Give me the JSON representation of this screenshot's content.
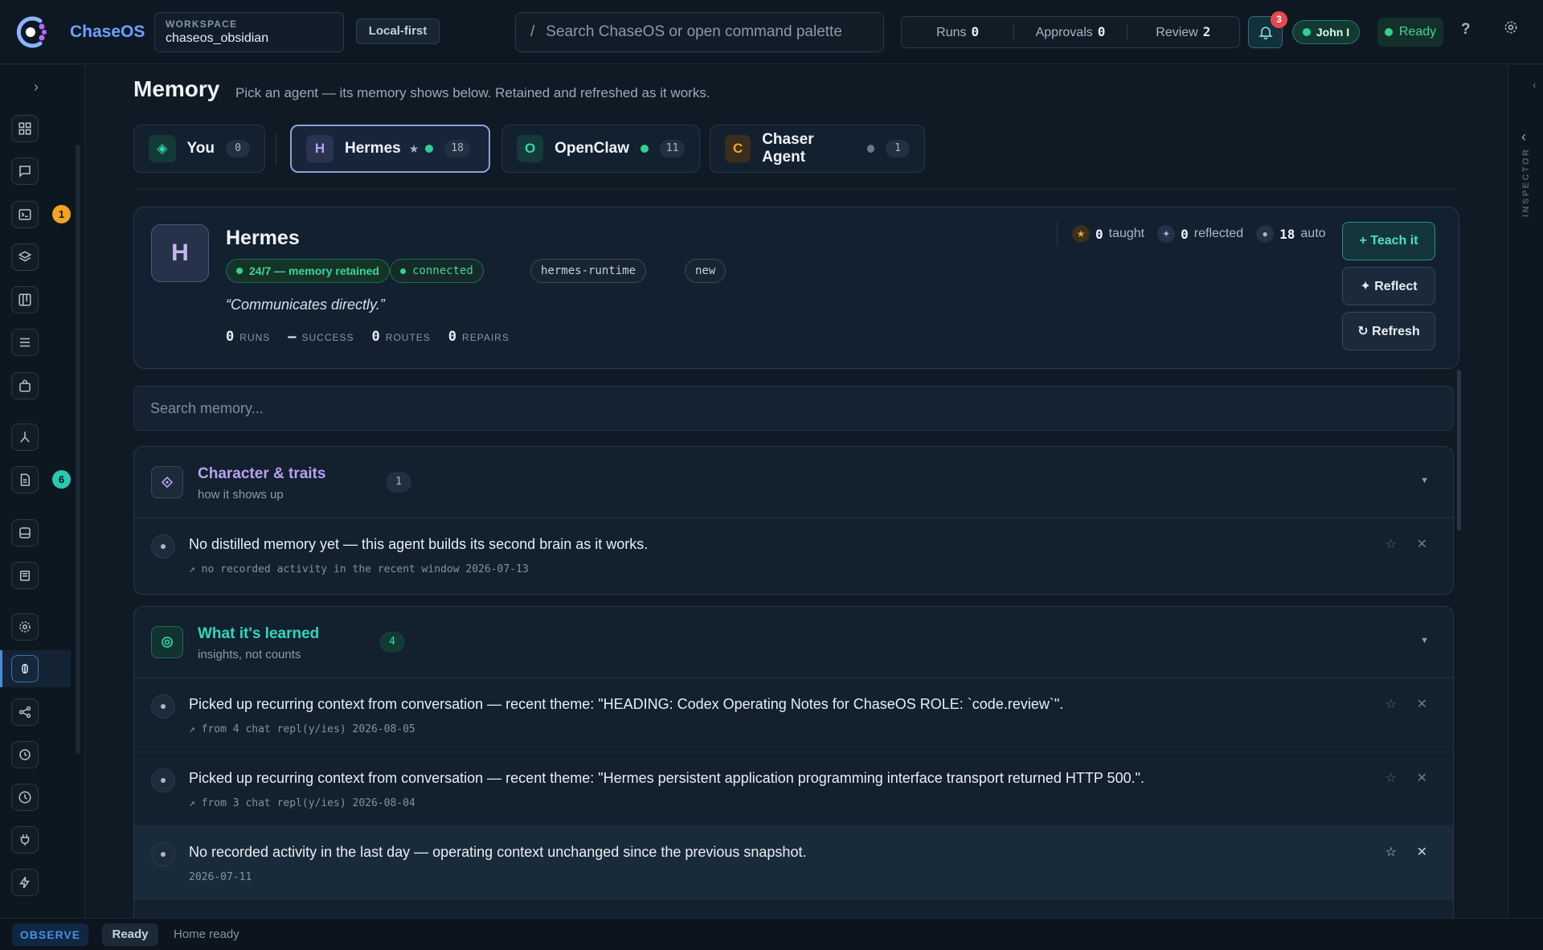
{
  "app": {
    "title": "ChaseOS",
    "workspace_label": "WORKSPACE",
    "workspace_name": "chaseos_obsidian",
    "mode_chip": "Local-first",
    "search_prefix": "/",
    "search_placeholder": "Search ChaseOS or open command palette"
  },
  "header_stats": [
    {
      "label": "Runs",
      "value": "0"
    },
    {
      "label": "Approvals",
      "value": "0"
    },
    {
      "label": "Review",
      "value": "2"
    }
  ],
  "notifications": {
    "count": "3"
  },
  "user": {
    "name": "John I"
  },
  "status_chip": {
    "label": "Ready",
    "color": "#2fd28d"
  },
  "nav": {
    "badges": {
      "runs": "1",
      "docs": "6"
    }
  },
  "inspector": {
    "label": "INSPECTOR"
  },
  "page": {
    "title": "Memory",
    "subtitle": "Pick an agent — its memory shows below. Retained and refreshed as it works."
  },
  "agent_tabs": [
    {
      "name": "You",
      "count": "0",
      "avatar": "◈",
      "active": false
    },
    {
      "name": "Hermes",
      "count": "18",
      "avatar": "H",
      "active": true
    },
    {
      "name": "OpenClaw",
      "count": "11",
      "avatar": "O",
      "active": false
    },
    {
      "name": "Chaser Agent",
      "count": "1",
      "avatar": "C",
      "active": false
    }
  ],
  "agent": {
    "initial": "H",
    "name": "Hermes",
    "tags": [
      "24/7 — memory retained",
      "connected",
      "hermes-runtime",
      "new"
    ],
    "quote": "“Communicates directly.”",
    "metrics": [
      {
        "value": "0",
        "label": "RUNS"
      },
      {
        "value": "–",
        "label": "SUCCESS"
      },
      {
        "value": "0",
        "label": "ROUTES"
      },
      {
        "value": "0",
        "label": "REPAIRS"
      }
    ],
    "counts": [
      {
        "value": "0",
        "label": "taught"
      },
      {
        "value": "0",
        "label": "reflected"
      },
      {
        "value": "18",
        "label": "auto"
      }
    ],
    "buttons": {
      "teach": "+ Teach it",
      "reflect": "✦ Reflect",
      "refresh": "↻ Refresh"
    }
  },
  "memory_search": {
    "placeholder": "Search memory..."
  },
  "sections": [
    {
      "title": "Character & traits",
      "subtitle": "how it shows up",
      "count": "1",
      "items": [
        {
          "text": "No distilled memory yet — this agent builds its second brain as it works.",
          "meta": "↗ no recorded activity in the recent window  2026-07-13"
        }
      ]
    },
    {
      "title": "What it's learned",
      "subtitle": "insights, not counts",
      "count": "4",
      "items": [
        {
          "text": "Picked up recurring context from conversation — recent theme: \"HEADING: Codex Operating Notes for ChaseOS ROLE: `code.review`\".",
          "meta": "↗ from 4 chat repl(y/ies)  2026-08-05"
        },
        {
          "text": "Picked up recurring context from conversation — recent theme: \"Hermes persistent application programming interface transport returned HTTP 500.\".",
          "meta": "↗ from 3 chat repl(y/ies)  2026-08-04"
        },
        {
          "text": "No recorded activity in the last day — operating context unchanged since the previous snapshot.",
          "meta": "2026-07-11"
        }
      ]
    }
  ],
  "bottom": {
    "mode": "OBSERVE",
    "status": "Ready",
    "message": "Home ready"
  },
  "colors": {
    "accent": "#6fa0ff",
    "teal": "#2fd8b8",
    "purple": "#b6a2f0",
    "badge_orange": "#f2a321",
    "badge_teal": "#28c9b0"
  }
}
